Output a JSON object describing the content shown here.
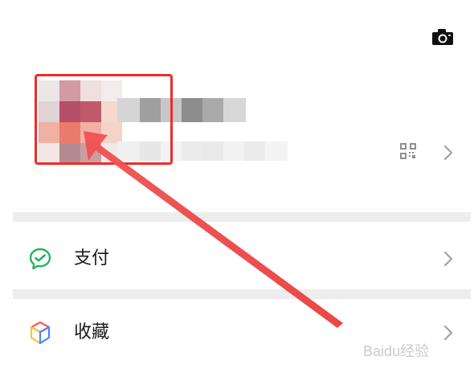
{
  "header": {
    "camera_icon": "camera-icon"
  },
  "profile": {
    "avatar_icon": "avatar-mosaic",
    "name_text": "",
    "id_text": "",
    "qr_icon": "qr-code-icon",
    "chevron_icon": "chevron-right-icon"
  },
  "annotation": {
    "box_color": "#ef2b2b",
    "arrow_color": "#f04a4a"
  },
  "menu": {
    "items": [
      {
        "label": "支付",
        "icon": "wechat-pay-icon",
        "accent": "#22b45b"
      },
      {
        "label": "收藏",
        "icon": "favorites-cube-icon",
        "accent": "#4b86ff"
      }
    ]
  },
  "watermark": {
    "text": "Baidu经验"
  },
  "colors": {
    "background": "#ffffff",
    "divider": "#ededed",
    "text": "#1a1a1a",
    "icon_gray": "#9e9e9e",
    "camera": "#111111"
  }
}
